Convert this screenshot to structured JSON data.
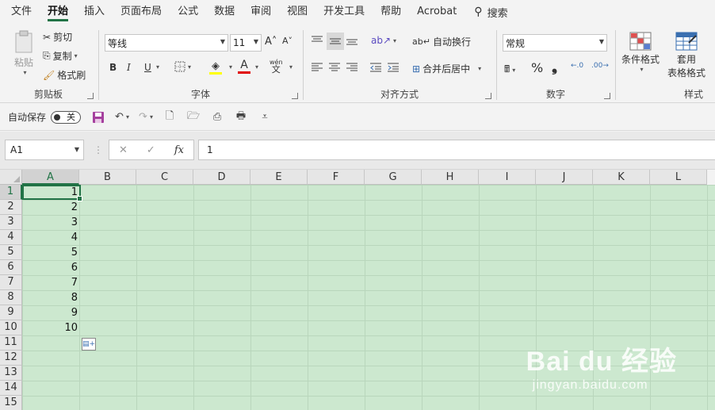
{
  "menu": {
    "tabs": [
      "文件",
      "开始",
      "插入",
      "页面布局",
      "公式",
      "数据",
      "审阅",
      "视图",
      "开发工具",
      "帮助",
      "Acrobat"
    ],
    "active_tab": "开始",
    "search_label": "搜索"
  },
  "ribbon": {
    "clipboard": {
      "label": "剪贴板",
      "paste": "粘贴",
      "cut": "剪切",
      "copy": "复制",
      "format_painter": "格式刷"
    },
    "font": {
      "label": "字体",
      "font_name": "等线",
      "font_size": "11",
      "bold": "B",
      "italic": "I",
      "underline": "U",
      "phonetic": "wén"
    },
    "alignment": {
      "label": "对齐方式",
      "wrap_text": "自动换行",
      "merge_center": "合并后居中"
    },
    "number": {
      "label": "数字",
      "format": "常规",
      "percent": "%",
      "comma": "❟"
    },
    "styles": {
      "label": "样式",
      "conditional": "条件格式",
      "table_line1": "套用",
      "table_line2": "表格格式"
    }
  },
  "qat": {
    "autosave_label": "自动保存",
    "toggle_state": "关"
  },
  "formula_bar": {
    "name_box": "A1",
    "fx": "fx",
    "value": "1"
  },
  "sheet": {
    "columns": [
      "A",
      "B",
      "C",
      "D",
      "E",
      "F",
      "G",
      "H",
      "I",
      "J",
      "K",
      "L"
    ],
    "rows": [
      "1",
      "2",
      "3",
      "4",
      "5",
      "6",
      "7",
      "8",
      "9",
      "10",
      "11",
      "12",
      "13",
      "14",
      "15"
    ],
    "column_a_values": [
      "1",
      "2",
      "3",
      "4",
      "5",
      "6",
      "7",
      "8",
      "9",
      "10"
    ],
    "selected_column": "A",
    "selected_row": "1"
  },
  "watermark": {
    "brand": "Bai du 经验",
    "url": "jingyan.baidu.com"
  },
  "colors": {
    "accent": "#217346",
    "cell_bg": "#cce8cf"
  }
}
